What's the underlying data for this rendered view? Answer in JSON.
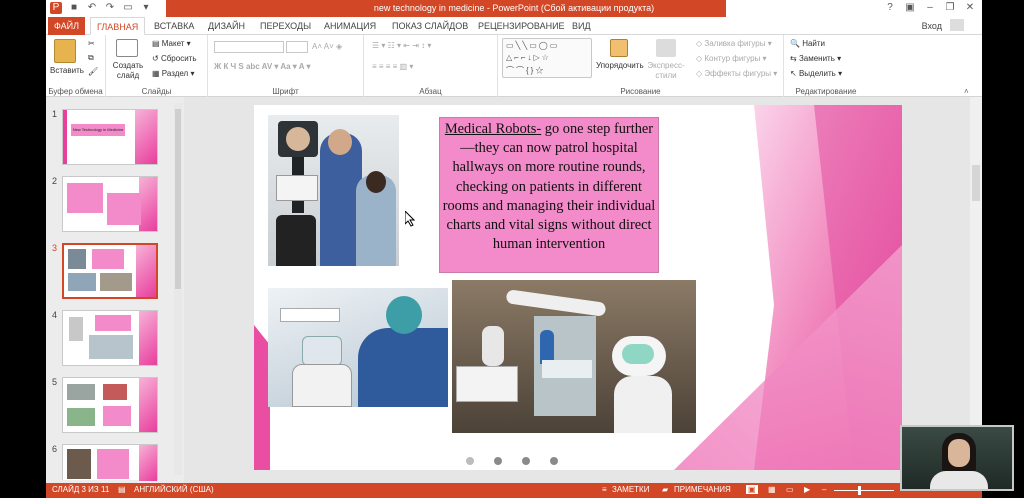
{
  "window": {
    "title": "new technology in medicine - PowerPoint (Сбой активации продукта)",
    "signin": "Вход",
    "help": "?"
  },
  "tabs": [
    "ФАЙЛ",
    "ГЛАВНАЯ",
    "ВСТАВКА",
    "ДИЗАЙН",
    "ПЕРЕХОДЫ",
    "АНИМАЦИЯ",
    "ПОКАЗ СЛАЙДОВ",
    "РЕЦЕНЗИРОВАНИЕ",
    "ВИД"
  ],
  "ribbon": {
    "clipboard": {
      "paste": "Вставить",
      "label": "Буфер обмена"
    },
    "slides": {
      "new_slide": "Создать слайд",
      "layout": "Макет",
      "reset": "Сбросить",
      "section": "Раздел",
      "label": "Слайды"
    },
    "font": {
      "label": "Шрифт"
    },
    "paragraph": {
      "label": "Абзац"
    },
    "drawing": {
      "arrange": "Упорядочить",
      "quick_styles": "Экспресс-стили",
      "fill": "Заливка фигуры",
      "outline": "Контур фигуры",
      "effects": "Эффекты фигуры",
      "label": "Рисование"
    },
    "editing": {
      "find": "Найти",
      "replace": "Заменить",
      "select": "Выделить",
      "label": "Редактирование"
    }
  },
  "thumbnails": [
    {
      "number": "1",
      "title": "New Technology in Medicine"
    },
    {
      "number": "2"
    },
    {
      "number": "3"
    },
    {
      "number": "4"
    },
    {
      "number": "5"
    },
    {
      "number": "6"
    }
  ],
  "slide": {
    "caption_heading": "Medical Robots-",
    "caption_body": " go one step further—they can now patrol hospital hallways on more routine rounds, checking on patients in different rooms and managing their individual charts and vital signs without direct human intervention"
  },
  "statusbar": {
    "slide_counter": "СЛАЙД 3 ИЗ 11",
    "language": "АНГЛИЙСКИЙ (США)",
    "notes": "ЗАМЕТКИ",
    "comments": "ПРИМЕЧАНИЯ"
  },
  "colors": {
    "accent": "#d24726",
    "pink": "#e83e9c",
    "caption_bg": "#f38ac9"
  }
}
